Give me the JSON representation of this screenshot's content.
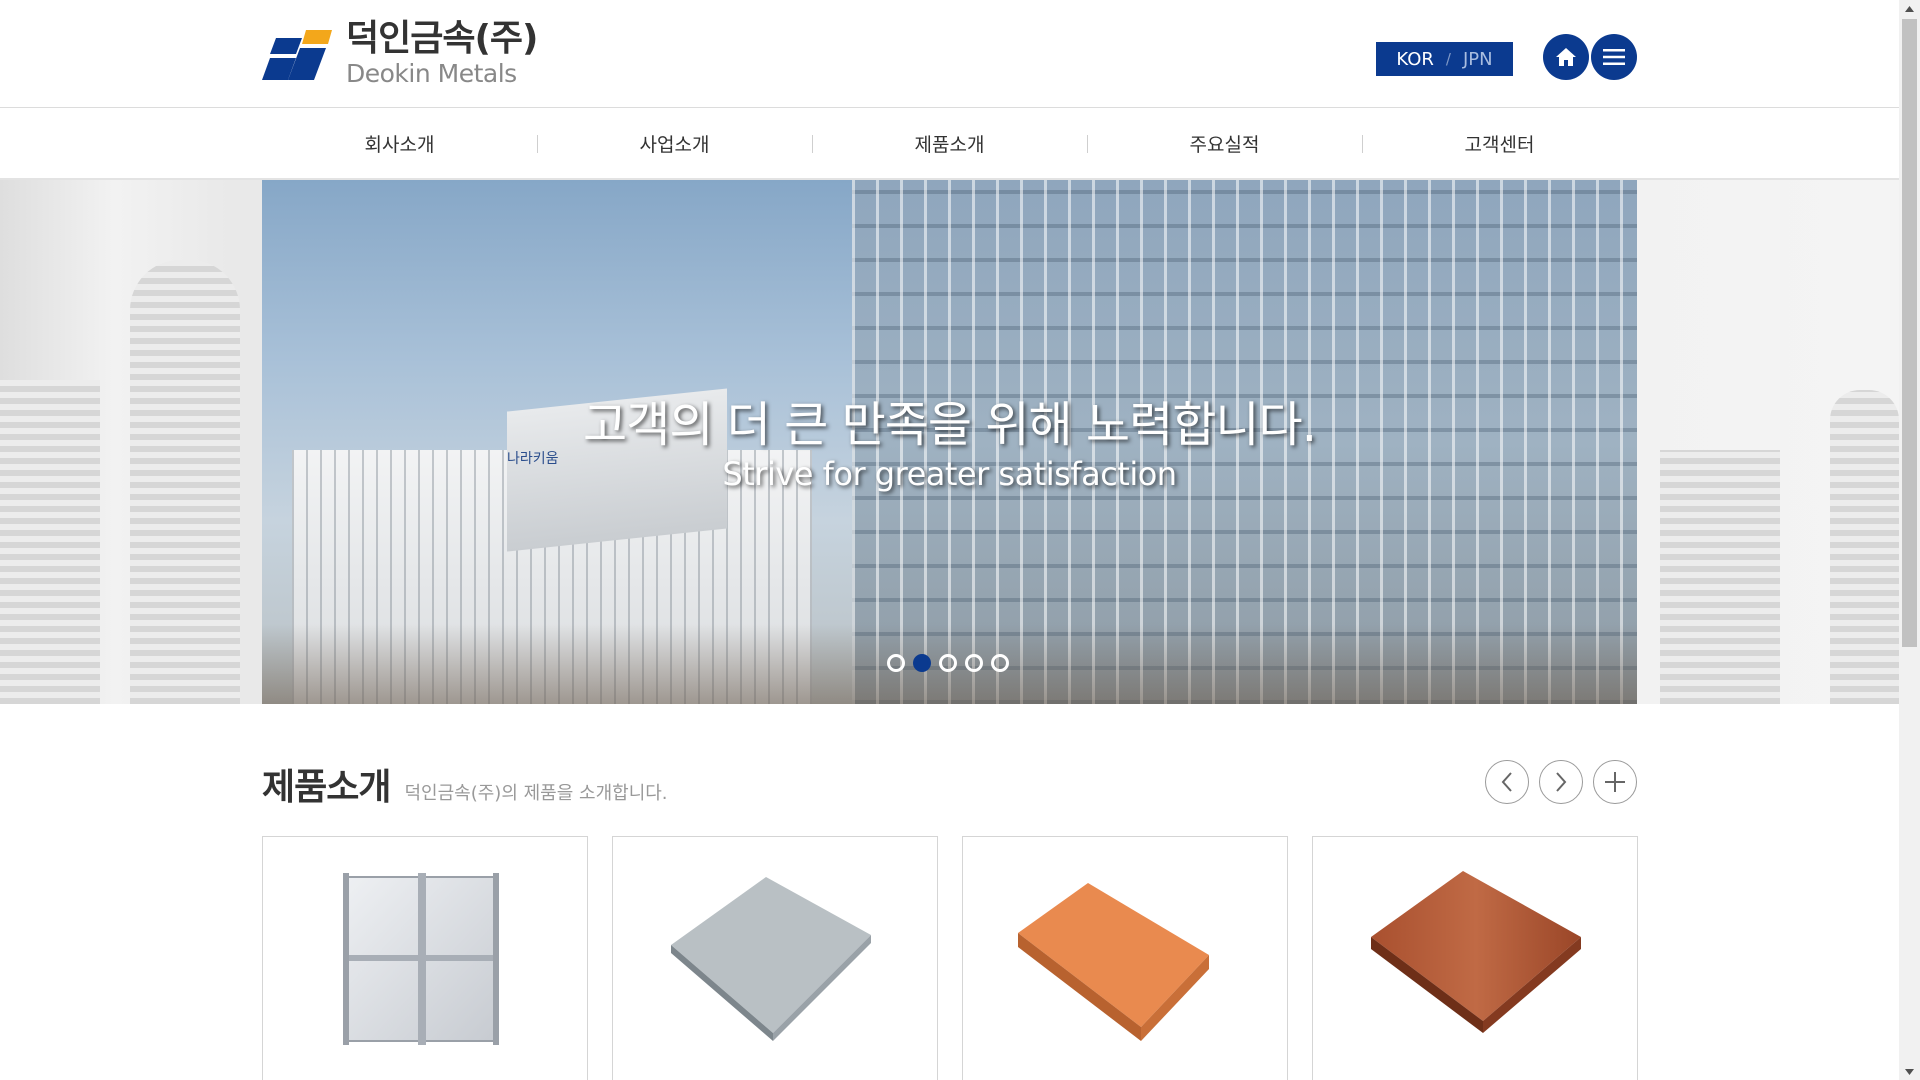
{
  "brand": {
    "name_ko": "덕인금속(주)",
    "name_en": "Deokin Metals",
    "colors": {
      "primary": "#0b3a8f",
      "logo_orange": "#f3a71b"
    }
  },
  "header": {
    "lang": {
      "kor": "KOR",
      "separator": "/",
      "jpn": "JPN"
    },
    "icons": {
      "home": "home-icon",
      "menu": "hamburger-menu-icon"
    }
  },
  "nav": {
    "items": [
      {
        "label": "회사소개"
      },
      {
        "label": "사업소개"
      },
      {
        "label": "제품소개"
      },
      {
        "label": "주요실적"
      },
      {
        "label": "고객센터"
      }
    ]
  },
  "visual": {
    "headline": "고객의 더 큰 만족을 위해 노력합니다.",
    "subline": "Strive for greater satisfaction",
    "sign": "나라키움",
    "slides_total": 5,
    "active_slide": 2
  },
  "products": {
    "title": "제품소개",
    "subtitle": "덕인금속(주)의 제품을 소개합니다.",
    "controls": {
      "prev": "chevron-left-icon",
      "next": "chevron-right-icon",
      "more": "plus-icon"
    },
    "cards": [
      {
        "image": "silver-panel-frame"
      },
      {
        "image": "gray-textured-panel"
      },
      {
        "image": "orange-panel"
      },
      {
        "image": "woodgrain-panel"
      }
    ]
  }
}
